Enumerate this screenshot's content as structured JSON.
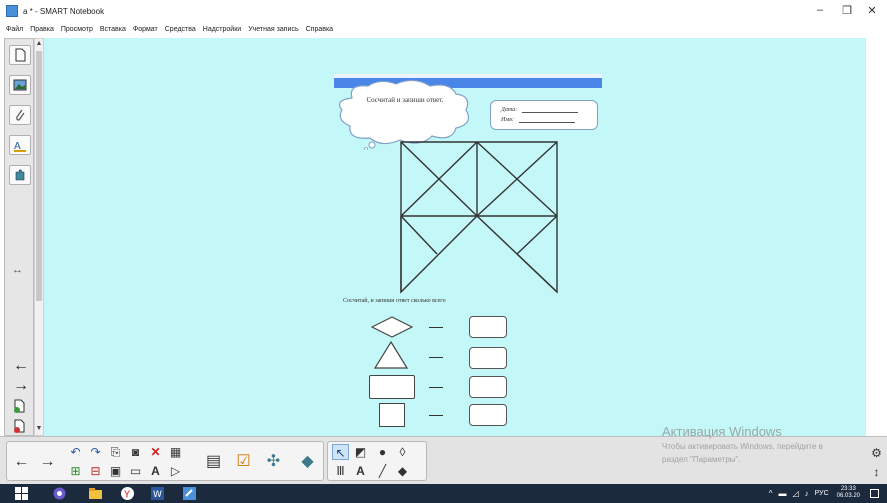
{
  "window": {
    "title": "a * - SMART Notebook",
    "minimize_label": "–",
    "maximize_label": "❐",
    "close_label": "✕"
  },
  "menu": [
    "Файл",
    "Правка",
    "Просмотр",
    "Вставка",
    "Формат",
    "Средства",
    "Надстройки",
    "Учетная запись",
    "Справка"
  ],
  "worksheet": {
    "instruction": "Сосчитай и запиши ответ.",
    "date_label": "Дата:",
    "name_label": "Имя:",
    "question": "Сосчитай, и запиши ответ сколько всего"
  },
  "watermark": {
    "title": "Активация Windows",
    "text_line1": "Чтобы активировать Windows, перейдите в",
    "text_line2": "раздел \"Параметры\"."
  },
  "taskbar": {
    "lang": "РУС",
    "time": "23:33",
    "date": "06.03.20"
  },
  "colors": {
    "canvas_bg": "#c4f7f7",
    "band": "#4a86e8",
    "taskbar": "#1c2a3e"
  },
  "icons": {
    "side": [
      "new-page-icon",
      "gallery-icon",
      "attachments-icon",
      "properties-icon",
      "addons-icon"
    ],
    "side_nav": [
      "resize-handle-icon",
      "arrow-left-icon",
      "arrow-right-icon",
      "add-page-icon",
      "delete-page-icon"
    ],
    "toolbar": [
      "prev-page-icon",
      "next-page-icon",
      "undo-icon",
      "redo-icon",
      "paste-icon",
      "screen-capture-icon",
      "delete-icon",
      "table-icon",
      "add-page-icon",
      "delete-page-icon",
      "save-icon",
      "screen-shade-icon",
      "text-icon",
      "shape-icon",
      "display-icon",
      "response-icon",
      "addon-icon",
      "document-camera-icon",
      "select-icon",
      "shapes-tool-icon",
      "fill-icon",
      "eraser-tool-icon",
      "pen-icon",
      "text-tool-icon",
      "line-icon",
      "eraser-icon"
    ]
  }
}
